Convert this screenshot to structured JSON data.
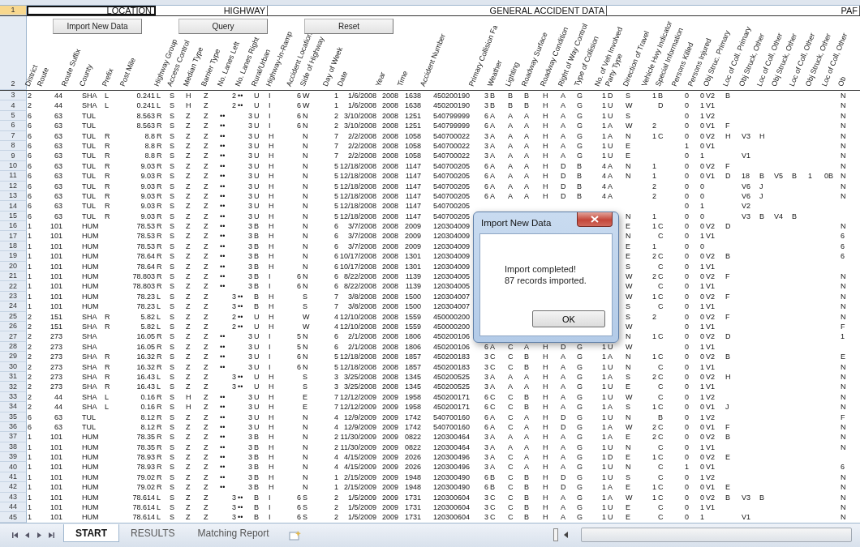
{
  "group_row": {
    "number": "1",
    "groups": [
      {
        "label": "LOCATION",
        "selected": true
      },
      {
        "label": "HIGHWAY",
        "selected": false
      },
      {
        "label": "GENERAL ACCIDENT DATA",
        "selected": false
      },
      {
        "label": "PAF",
        "selected": false
      }
    ]
  },
  "buttons": [
    "Import New Data",
    "Query",
    "Reset"
  ],
  "header_row": {
    "number": "2",
    "columns": [
      "District",
      "Route",
      "Route Suffix",
      "County",
      "Prefix",
      "Post Mile",
      "Highway Group",
      "Access Control",
      "Median Type",
      "Barrier Type",
      "No. Lanes Left",
      "No. Lanes Right",
      "Rural/Urban",
      "Highway-In-Ramp",
      "Accident Location",
      "Side of Highway",
      "Day of Week",
      "Date",
      "Year",
      "Time",
      "Accident Number",
      "Primary Collision Fa",
      "Weather",
      "Lighting",
      "Roadway Surface",
      "Roadway Condition",
      "Right of Way Control",
      "Type of Collision",
      "No. of Veh Involved",
      "Party Type",
      "Direction of Travel",
      "Vehicle Hwy Indicator",
      "Special Information",
      "Persons Killed",
      "Persons Injured",
      "Obj Struc. Primary",
      "Loc of Coll. Primary",
      "Obj Struck, Other",
      "Loc of Coll, Other",
      "Obj Struck, Other",
      "Loc of Coll, Other",
      "Obj Struck, Other",
      "Loc of Coll, Other",
      "Ob"
    ]
  },
  "rows": [
    {
      "number": "3",
      "cells": [
        "2",
        "44",
        null,
        "SHA",
        "L",
        "0.241",
        "L",
        "S",
        "H",
        "Z",
        "2",
        "••",
        "U",
        "I",
        "6",
        "W",
        "1",
        "1/6/2008",
        "2008",
        "1638",
        "450200190",
        "3",
        "B",
        "B",
        "B",
        "H",
        "A",
        "G",
        "1",
        "D",
        "S",
        "1",
        "B",
        "0",
        "0",
        "V2",
        "B",
        null,
        null,
        null,
        null,
        null,
        null,
        "N"
      ]
    },
    {
      "number": "4",
      "cells": [
        "2",
        "44",
        null,
        "SHA",
        "L",
        "0.241",
        "L",
        "S",
        "H",
        "Z",
        "2",
        "••",
        "U",
        "I",
        "6",
        "W",
        "1",
        "1/6/2008",
        "2008",
        "1638",
        "450200190",
        "3",
        "B",
        "B",
        "B",
        "H",
        "A",
        "G",
        "1",
        "U",
        "W",
        null,
        "D",
        "0",
        "1",
        "V1",
        null,
        null,
        null,
        null,
        null,
        null,
        null,
        "N"
      ]
    },
    {
      "number": "5",
      "cells": [
        "6",
        "63",
        null,
        "TUL",
        null,
        "8.563",
        "R",
        "S",
        "Z",
        "Z",
        "••",
        "3",
        "U",
        "I",
        "6",
        "N",
        "2",
        "3/10/2008",
        "2008",
        "1251",
        "540799999",
        "6",
        "A",
        "A",
        "A",
        "H",
        "A",
        "G",
        "1",
        "U",
        "S",
        null,
        null,
        "0",
        "1",
        "V2",
        null,
        null,
        null,
        null,
        null,
        null,
        null,
        "N"
      ]
    },
    {
      "number": "6",
      "cells": [
        "6",
        "63",
        null,
        "TUL",
        null,
        "8.563",
        "R",
        "S",
        "Z",
        "Z",
        "••",
        "3",
        "U",
        "I",
        "6",
        "N",
        "2",
        "3/10/2008",
        "2008",
        "1251",
        "540799999",
        "6",
        "A",
        "A",
        "A",
        "H",
        "A",
        "G",
        "1",
        "A",
        "W",
        "2",
        null,
        "0",
        "0",
        "V1",
        "F",
        null,
        null,
        null,
        null,
        null,
        null,
        "N"
      ]
    },
    {
      "number": "7",
      "cells": [
        "6",
        "63",
        null,
        "TUL",
        "R",
        "8.8",
        "R",
        "S",
        "Z",
        "Z",
        "••",
        "3",
        "U",
        "H",
        null,
        "N",
        "7",
        "2/2/2008",
        "2008",
        "1058",
        "540700022",
        "3",
        "A",
        "A",
        "A",
        "H",
        "A",
        "G",
        "1",
        "A",
        "N",
        "1",
        "C",
        "0",
        "0",
        "V2",
        "H",
        "V3",
        "H",
        null,
        null,
        null,
        null,
        "N"
      ]
    },
    {
      "number": "8",
      "cells": [
        "6",
        "63",
        null,
        "TUL",
        "R",
        "8.8",
        "R",
        "S",
        "Z",
        "Z",
        "••",
        "3",
        "U",
        "H",
        null,
        "N",
        "7",
        "2/2/2008",
        "2008",
        "1058",
        "540700022",
        "3",
        "A",
        "A",
        "A",
        "H",
        "A",
        "G",
        "1",
        "U",
        "E",
        null,
        null,
        "1",
        "0",
        "V1",
        null,
        null,
        null,
        null,
        null,
        null,
        null,
        "N"
      ]
    },
    {
      "number": "9",
      "cells": [
        "6",
        "63",
        null,
        "TUL",
        "R",
        "8.8",
        "R",
        "S",
        "Z",
        "Z",
        "••",
        "3",
        "U",
        "H",
        null,
        "N",
        "7",
        "2/2/2008",
        "2008",
        "1058",
        "540700022",
        "3",
        "A",
        "A",
        "A",
        "H",
        "A",
        "G",
        "1",
        "U",
        "E",
        null,
        null,
        "0",
        "1",
        null,
        null,
        "V1",
        null,
        null,
        null,
        null,
        null,
        "N"
      ]
    },
    {
      "number": "10",
      "cells": [
        "6",
        "63",
        null,
        "TUL",
        "R",
        "9.03",
        "R",
        "S",
        "Z",
        "Z",
        "••",
        "3",
        "U",
        "H",
        null,
        "N",
        "5",
        "12/18/2008",
        "2008",
        "1147",
        "540700205",
        "6",
        "A",
        "A",
        "A",
        "H",
        "D",
        "B",
        "4",
        "A",
        "N",
        "1",
        null,
        "0",
        "0",
        "V2",
        "F",
        null,
        null,
        null,
        null,
        null,
        null,
        "N"
      ]
    },
    {
      "number": "11",
      "cells": [
        "6",
        "63",
        null,
        "TUL",
        "R",
        "9.03",
        "R",
        "S",
        "Z",
        "Z",
        "••",
        "3",
        "U",
        "H",
        null,
        "N",
        "5",
        "12/18/2008",
        "2008",
        "1147",
        "540700205",
        "6",
        "A",
        "A",
        "A",
        "H",
        "D",
        "B",
        "4",
        "A",
        "N",
        "1",
        null,
        "0",
        "0",
        "V1",
        "D",
        "18",
        "B",
        "V5",
        "B",
        "1",
        "0B",
        "N"
      ]
    },
    {
      "number": "12",
      "cells": [
        "6",
        "63",
        null,
        "TUL",
        "R",
        "9.03",
        "R",
        "S",
        "Z",
        "Z",
        "••",
        "3",
        "U",
        "H",
        null,
        "N",
        "5",
        "12/18/2008",
        "2008",
        "1147",
        "540700205",
        "6",
        "A",
        "A",
        "A",
        "H",
        "D",
        "B",
        "4",
        "A",
        null,
        "2",
        null,
        "0",
        "0",
        null,
        null,
        "V6",
        "J",
        null,
        null,
        null,
        null,
        "N"
      ]
    },
    {
      "number": "13",
      "cells": [
        "6",
        "63",
        null,
        "TUL",
        "R",
        "9.03",
        "R",
        "S",
        "Z",
        "Z",
        "••",
        "3",
        "U",
        "H",
        null,
        "N",
        "5",
        "12/18/2008",
        "2008",
        "1147",
        "540700205",
        "6",
        "A",
        "A",
        "A",
        "H",
        "D",
        "B",
        "4",
        "A",
        null,
        "2",
        null,
        "0",
        "0",
        null,
        null,
        "V6",
        "J",
        null,
        null,
        null,
        null,
        "N"
      ]
    },
    {
      "number": "14",
      "cells": [
        "6",
        "63",
        null,
        "TUL",
        "R",
        "9.03",
        "R",
        "S",
        "Z",
        "Z",
        "••",
        "3",
        "U",
        "H",
        null,
        "N",
        "5",
        "12/18/2008",
        "2008",
        "1147",
        "540700205",
        null,
        null,
        null,
        null,
        null,
        null,
        null,
        null,
        null,
        null,
        null,
        null,
        "0",
        "1",
        null,
        null,
        "V2",
        null,
        null,
        null,
        null,
        null,
        null
      ]
    },
    {
      "number": "15",
      "cells": [
        "6",
        "63",
        null,
        "TUL",
        "R",
        "9.03",
        "R",
        "S",
        "Z",
        "Z",
        "••",
        "3",
        "U",
        "H",
        null,
        "N",
        "5",
        "12/18/2008",
        "2008",
        "1147",
        "540700205",
        null,
        null,
        null,
        null,
        null,
        null,
        null,
        null,
        null,
        "N",
        "1",
        null,
        "0",
        "0",
        null,
        null,
        "V3",
        "B",
        "V4",
        "B",
        null,
        null,
        null
      ]
    },
    {
      "number": "16",
      "cells": [
        "1",
        "101",
        null,
        "HUM",
        null,
        "78.53",
        "R",
        "S",
        "Z",
        "Z",
        "••",
        "3",
        "B",
        "H",
        null,
        "N",
        "6",
        "3/7/2008",
        "2008",
        "2009",
        "120304009",
        null,
        null,
        null,
        null,
        null,
        null,
        null,
        null,
        null,
        "E",
        "1",
        "C",
        "0",
        "0",
        "V2",
        "D",
        null,
        null,
        null,
        null,
        null,
        null,
        "N"
      ]
    },
    {
      "number": "17",
      "cells": [
        "1",
        "101",
        null,
        "HUM",
        null,
        "78.53",
        "R",
        "S",
        "Z",
        "Z",
        "••",
        "3",
        "B",
        "H",
        null,
        "N",
        "6",
        "3/7/2008",
        "2008",
        "2009",
        "120304009",
        null,
        null,
        null,
        null,
        null,
        null,
        null,
        null,
        null,
        "N",
        null,
        "C",
        "0",
        "1",
        "V1",
        null,
        null,
        null,
        null,
        null,
        null,
        null,
        "6"
      ]
    },
    {
      "number": "18",
      "cells": [
        "1",
        "101",
        null,
        "HUM",
        null,
        "78.53",
        "R",
        "S",
        "Z",
        "Z",
        "••",
        "3",
        "B",
        "H",
        null,
        "N",
        "6",
        "3/7/2008",
        "2008",
        "2009",
        "120304009",
        null,
        null,
        null,
        null,
        null,
        null,
        null,
        null,
        null,
        "E",
        "1",
        null,
        "0",
        "0",
        null,
        null,
        null,
        null,
        null,
        null,
        null,
        null,
        "6"
      ]
    },
    {
      "number": "19",
      "cells": [
        "1",
        "101",
        null,
        "HUM",
        null,
        "78.64",
        "R",
        "S",
        "Z",
        "Z",
        "••",
        "3",
        "B",
        "H",
        null,
        "N",
        "6",
        "10/17/2008",
        "2008",
        "1301",
        "120304009",
        null,
        null,
        null,
        null,
        null,
        null,
        null,
        null,
        null,
        "E",
        "2",
        "C",
        "0",
        "0",
        "V2",
        "B",
        null,
        null,
        null,
        null,
        null,
        null,
        "6"
      ]
    },
    {
      "number": "20",
      "cells": [
        "1",
        "101",
        null,
        "HUM",
        null,
        "78.64",
        "R",
        "S",
        "Z",
        "Z",
        "••",
        "3",
        "B",
        "H",
        null,
        "N",
        "6",
        "10/17/2008",
        "2008",
        "1301",
        "120304009",
        null,
        null,
        null,
        null,
        null,
        null,
        null,
        null,
        null,
        "S",
        null,
        "C",
        "0",
        "1",
        "V1",
        null,
        null,
        null,
        null,
        null,
        null,
        null,
        null
      ]
    },
    {
      "number": "21",
      "cells": [
        "1",
        "101",
        null,
        "HUM",
        null,
        "78.803",
        "R",
        "S",
        "Z",
        "Z",
        "••",
        "3",
        "B",
        "I",
        "6",
        "N",
        "6",
        "8/22/2008",
        "2008",
        "1139",
        "120304005",
        null,
        null,
        null,
        null,
        null,
        null,
        null,
        null,
        null,
        "W",
        "2",
        "C",
        "0",
        "0",
        "V2",
        "F",
        null,
        null,
        null,
        null,
        null,
        null,
        "N"
      ]
    },
    {
      "number": "22",
      "cells": [
        "1",
        "101",
        null,
        "HUM",
        null,
        "78.803",
        "R",
        "S",
        "Z",
        "Z",
        "••",
        "3",
        "B",
        "I",
        "6",
        "N",
        "6",
        "8/22/2008",
        "2008",
        "1139",
        "120304005",
        null,
        null,
        null,
        null,
        null,
        null,
        null,
        null,
        null,
        "W",
        null,
        "C",
        "0",
        "1",
        "V1",
        null,
        null,
        null,
        null,
        null,
        null,
        null,
        "N"
      ]
    },
    {
      "number": "23",
      "cells": [
        "1",
        "101",
        null,
        "HUM",
        null,
        "78.23",
        "L",
        "S",
        "Z",
        "Z",
        "3",
        "••",
        "B",
        "H",
        null,
        "S",
        "7",
        "3/8/2008",
        "2008",
        "1500",
        "120304007",
        null,
        null,
        null,
        null,
        null,
        null,
        null,
        null,
        null,
        "W",
        "1",
        "C",
        "0",
        "0",
        "V2",
        "F",
        null,
        null,
        null,
        null,
        null,
        null,
        "N"
      ]
    },
    {
      "number": "24",
      "cells": [
        "1",
        "101",
        null,
        "HUM",
        null,
        "78.23",
        "L",
        "S",
        "Z",
        "Z",
        "3",
        "••",
        "B",
        "H",
        null,
        "S",
        "7",
        "3/8/2008",
        "2008",
        "1500",
        "120304007",
        null,
        null,
        null,
        null,
        null,
        null,
        null,
        null,
        null,
        "S",
        null,
        "C",
        "0",
        "1",
        "V1",
        null,
        null,
        null,
        null,
        null,
        null,
        null,
        "N"
      ]
    },
    {
      "number": "25",
      "cells": [
        "2",
        "151",
        null,
        "SHA",
        "R",
        "5.82",
        "L",
        "S",
        "Z",
        "Z",
        "2",
        "••",
        "U",
        "H",
        null,
        "W",
        "4",
        "12/10/2008",
        "2008",
        "1559",
        "450000200",
        null,
        null,
        null,
        null,
        null,
        null,
        null,
        null,
        null,
        "S",
        "2",
        null,
        "0",
        "0",
        "V2",
        "F",
        null,
        null,
        null,
        null,
        null,
        null,
        "N"
      ]
    },
    {
      "number": "26",
      "cells": [
        "2",
        "151",
        null,
        "SHA",
        "R",
        "5.82",
        "L",
        "S",
        "Z",
        "Z",
        "2",
        "••",
        "U",
        "H",
        null,
        "W",
        "4",
        "12/10/2008",
        "2008",
        "1559",
        "450000200",
        null,
        null,
        null,
        null,
        null,
        null,
        null,
        null,
        null,
        "W",
        null,
        null,
        "0",
        "1",
        "V1",
        null,
        null,
        null,
        null,
        null,
        null,
        null,
        "F"
      ]
    },
    {
      "number": "27",
      "cells": [
        "2",
        "273",
        null,
        "SHA",
        null,
        "16.05",
        "R",
        "S",
        "Z",
        "Z",
        "••",
        "3",
        "U",
        "I",
        "5",
        "N",
        "6",
        "2/1/2008",
        "2008",
        "1806",
        "450200106",
        null,
        null,
        null,
        null,
        null,
        null,
        null,
        null,
        null,
        "N",
        "1",
        "C",
        "0",
        "0",
        "V2",
        "D",
        null,
        null,
        null,
        null,
        null,
        null,
        "1"
      ]
    },
    {
      "number": "28",
      "cells": [
        "2",
        "273",
        null,
        "SHA",
        null,
        "16.05",
        "R",
        "S",
        "Z",
        "Z",
        "••",
        "3",
        "U",
        "I",
        "5",
        "N",
        "6",
        "2/1/2008",
        "2008",
        "1806",
        "450200106",
        "6",
        "A",
        "C",
        "A",
        "H",
        "D",
        "G",
        "1",
        "U",
        "W",
        null,
        null,
        "0",
        "1",
        "V1",
        null,
        null,
        null,
        null,
        null,
        null,
        null,
        null
      ]
    },
    {
      "number": "29",
      "cells": [
        "2",
        "273",
        null,
        "SHA",
        "R",
        "16.32",
        "R",
        "S",
        "Z",
        "Z",
        "••",
        "3",
        "U",
        "I",
        "6",
        "N",
        "5",
        "12/18/2008",
        "2008",
        "1857",
        "450200183",
        "3",
        "C",
        "C",
        "B",
        "H",
        "A",
        "G",
        "1",
        "A",
        "N",
        "1",
        "C",
        "0",
        "0",
        "V2",
        "B",
        null,
        null,
        null,
        null,
        null,
        null,
        "E"
      ]
    },
    {
      "number": "30",
      "cells": [
        "2",
        "273",
        null,
        "SHA",
        "R",
        "16.32",
        "R",
        "S",
        "Z",
        "Z",
        "••",
        "3",
        "U",
        "I",
        "6",
        "N",
        "5",
        "12/18/2008",
        "2008",
        "1857",
        "450200183",
        "3",
        "C",
        "C",
        "B",
        "H",
        "A",
        "G",
        "1",
        "U",
        "N",
        null,
        "C",
        "0",
        "1",
        "V1",
        null,
        null,
        null,
        null,
        null,
        null,
        null,
        "N"
      ]
    },
    {
      "number": "31",
      "cells": [
        "2",
        "273",
        null,
        "SHA",
        "R",
        "16.43",
        "L",
        "S",
        "Z",
        "Z",
        "3",
        "••",
        "U",
        "H",
        null,
        "S",
        "3",
        "3/25/2008",
        "2008",
        "1345",
        "450200525",
        "3",
        "A",
        "A",
        "A",
        "H",
        "A",
        "G",
        "1",
        "A",
        "S",
        "2",
        "C",
        "0",
        "0",
        "V2",
        "H",
        null,
        null,
        null,
        null,
        null,
        null,
        "N"
      ]
    },
    {
      "number": "32",
      "cells": [
        "2",
        "273",
        null,
        "SHA",
        "R",
        "16.43",
        "L",
        "S",
        "Z",
        "Z",
        "3",
        "••",
        "U",
        "H",
        null,
        "S",
        "3",
        "3/25/2008",
        "2008",
        "1345",
        "450200525",
        "3",
        "A",
        "A",
        "A",
        "H",
        "A",
        "G",
        "1",
        "U",
        "E",
        null,
        "C",
        "0",
        "1",
        "V1",
        null,
        null,
        null,
        null,
        null,
        null,
        null,
        "N"
      ]
    },
    {
      "number": "33",
      "cells": [
        "2",
        "44",
        null,
        "SHA",
        "L",
        "0.16",
        "R",
        "S",
        "H",
        "Z",
        "••",
        "3",
        "U",
        "H",
        null,
        "E",
        "7",
        "12/12/2009",
        "2009",
        "1958",
        "450200171",
        "6",
        "C",
        "C",
        "B",
        "H",
        "A",
        "G",
        "1",
        "U",
        "W",
        null,
        "C",
        "0",
        "1",
        "V2",
        null,
        null,
        null,
        null,
        null,
        null,
        null,
        "N"
      ]
    },
    {
      "number": "34",
      "cells": [
        "2",
        "44",
        null,
        "SHA",
        "L",
        "0.16",
        "R",
        "S",
        "H",
        "Z",
        "••",
        "3",
        "U",
        "H",
        null,
        "E",
        "7",
        "12/12/2009",
        "2009",
        "1958",
        "450200171",
        "6",
        "C",
        "C",
        "B",
        "H",
        "A",
        "G",
        "1",
        "A",
        "S",
        "1",
        "C",
        "0",
        "0",
        "V1",
        "J",
        null,
        null,
        null,
        null,
        null,
        null,
        "N"
      ]
    },
    {
      "number": "35",
      "cells": [
        "6",
        "63",
        null,
        "TUL",
        null,
        "8.12",
        "R",
        "S",
        "Z",
        "Z",
        "••",
        "3",
        "U",
        "H",
        null,
        "N",
        "4",
        "12/9/2009",
        "2009",
        "1742",
        "540700160",
        "6",
        "A",
        "C",
        "A",
        "H",
        "D",
        "G",
        "1",
        "U",
        "N",
        null,
        "B",
        "0",
        "1",
        "V2",
        null,
        null,
        null,
        null,
        null,
        null,
        null,
        "F"
      ]
    },
    {
      "number": "36",
      "cells": [
        "6",
        "63",
        null,
        "TUL",
        null,
        "8.12",
        "R",
        "S",
        "Z",
        "Z",
        "••",
        "3",
        "U",
        "H",
        null,
        "N",
        "4",
        "12/9/2009",
        "2009",
        "1742",
        "540700160",
        "6",
        "A",
        "C",
        "A",
        "H",
        "D",
        "G",
        "1",
        "A",
        "W",
        "2",
        "C",
        "0",
        "0",
        "V1",
        "F",
        null,
        null,
        null,
        null,
        null,
        null,
        "N"
      ]
    },
    {
      "number": "37",
      "cells": [
        "1",
        "101",
        null,
        "HUM",
        null,
        "78.35",
        "R",
        "S",
        "Z",
        "Z",
        "••",
        "3",
        "B",
        "H",
        null,
        "N",
        "2",
        "11/30/2009",
        "2009",
        "0822",
        "120300464",
        "3",
        "A",
        "A",
        "A",
        "H",
        "A",
        "G",
        "1",
        "A",
        "E",
        "2",
        "C",
        "0",
        "0",
        "V2",
        "B",
        null,
        null,
        null,
        null,
        null,
        null,
        "N"
      ]
    },
    {
      "number": "38",
      "cells": [
        "1",
        "101",
        null,
        "HUM",
        null,
        "78.35",
        "R",
        "S",
        "Z",
        "Z",
        "••",
        "3",
        "B",
        "H",
        null,
        "N",
        "2",
        "11/30/2009",
        "2009",
        "0822",
        "120300464",
        "3",
        "A",
        "A",
        "A",
        "H",
        "A",
        "G",
        "1",
        "U",
        "N",
        null,
        "C",
        "0",
        "1",
        "V1",
        null,
        null,
        null,
        null,
        null,
        null,
        null,
        "N"
      ]
    },
    {
      "number": "39",
      "cells": [
        "1",
        "101",
        null,
        "HUM",
        null,
        "78.93",
        "R",
        "S",
        "Z",
        "Z",
        "••",
        "3",
        "B",
        "H",
        null,
        "N",
        "4",
        "4/15/2009",
        "2009",
        "2026",
        "120300496",
        "3",
        "A",
        "C",
        "A",
        "H",
        "A",
        "G",
        "1",
        "D",
        "E",
        "1",
        "C",
        "0",
        "0",
        "V2",
        "E",
        null,
        null,
        null,
        null,
        null,
        null,
        null
      ]
    },
    {
      "number": "40",
      "cells": [
        "1",
        "101",
        null,
        "HUM",
        null,
        "78.93",
        "R",
        "S",
        "Z",
        "Z",
        "••",
        "3",
        "B",
        "H",
        null,
        "N",
        "4",
        "4/15/2009",
        "2009",
        "2026",
        "120300496",
        "3",
        "A",
        "C",
        "A",
        "H",
        "A",
        "G",
        "1",
        "U",
        "N",
        null,
        "C",
        "1",
        "0",
        "V1",
        null,
        null,
        null,
        null,
        null,
        null,
        null,
        "6"
      ]
    },
    {
      "number": "41",
      "cells": [
        "1",
        "101",
        null,
        "HUM",
        null,
        "79.02",
        "R",
        "S",
        "Z",
        "Z",
        "••",
        "3",
        "B",
        "H",
        null,
        "N",
        "1",
        "2/15/2009",
        "2009",
        "1948",
        "120300490",
        "6",
        "B",
        "C",
        "B",
        "H",
        "D",
        "G",
        "1",
        "U",
        "S",
        null,
        "C",
        "0",
        "1",
        "V2",
        null,
        null,
        null,
        null,
        null,
        null,
        null,
        "N"
      ]
    },
    {
      "number": "42",
      "cells": [
        "1",
        "101",
        null,
        "HUM",
        null,
        "79.02",
        "R",
        "S",
        "Z",
        "Z",
        "••",
        "3",
        "B",
        "H",
        null,
        "N",
        "1",
        "2/15/2009",
        "2009",
        "1948",
        "120300490",
        "6",
        "B",
        "C",
        "B",
        "H",
        "D",
        "G",
        "1",
        "A",
        "E",
        "1",
        "C",
        "0",
        "0",
        "V1",
        "E",
        null,
        null,
        null,
        null,
        null,
        null,
        "N"
      ]
    },
    {
      "number": "43",
      "cells": [
        "1",
        "101",
        null,
        "HUM",
        null,
        "78.614",
        "L",
        "S",
        "Z",
        "Z",
        "3",
        "••",
        "B",
        "I",
        "6",
        "S",
        "2",
        "1/5/2009",
        "2009",
        "1731",
        "120300604",
        "3",
        "C",
        "C",
        "B",
        "H",
        "A",
        "G",
        "1",
        "A",
        "W",
        "1",
        "C",
        "0",
        "0",
        "V2",
        "B",
        "V3",
        "B",
        null,
        null,
        null,
        null,
        "N"
      ]
    },
    {
      "number": "44",
      "cells": [
        "1",
        "101",
        null,
        "HUM",
        null,
        "78.614",
        "L",
        "S",
        "Z",
        "Z",
        "3",
        "••",
        "B",
        "I",
        "6",
        "S",
        "2",
        "1/5/2009",
        "2009",
        "1731",
        "120300604",
        "3",
        "C",
        "C",
        "B",
        "H",
        "A",
        "G",
        "1",
        "U",
        "E",
        null,
        "C",
        "0",
        "1",
        "V1",
        null,
        null,
        null,
        null,
        null,
        null,
        null,
        "N"
      ]
    },
    {
      "number": "45",
      "cells": [
        "1",
        "101",
        null,
        "HUM",
        null,
        "78.614",
        "L",
        "S",
        "Z",
        "Z",
        "3",
        "••",
        "B",
        "I",
        "6",
        "S",
        "2",
        "1/5/2009",
        "2009",
        "1731",
        "120300604",
        "3",
        "C",
        "C",
        "B",
        "H",
        "A",
        "G",
        "1",
        "U",
        "E",
        null,
        "C",
        "0",
        "1",
        null,
        null,
        "V1",
        null,
        null,
        null,
        null,
        null,
        "N"
      ]
    }
  ],
  "dialog": {
    "title": "Import New Data",
    "message": [
      "Import completed!",
      "87 records imported."
    ],
    "ok": "OK"
  },
  "sheet_tabs": [
    {
      "label": "START",
      "selected": true
    },
    {
      "label": "RESULTS",
      "selected": false
    },
    {
      "label": "Matching Report",
      "selected": false
    }
  ]
}
